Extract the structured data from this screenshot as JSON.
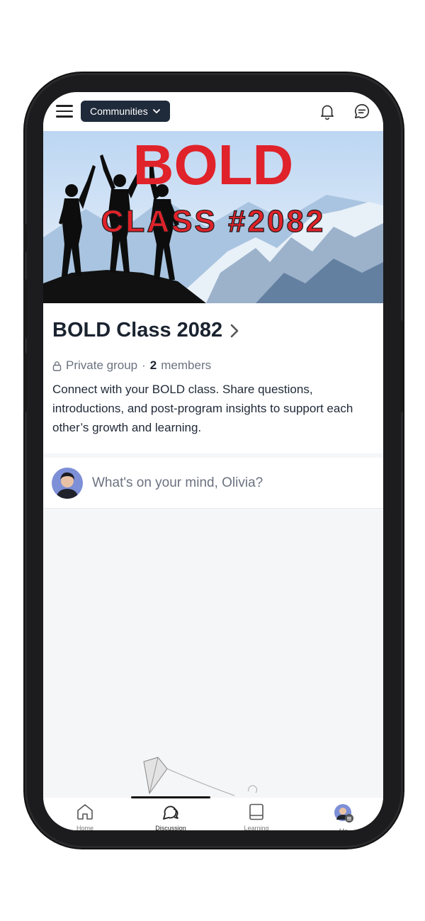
{
  "header": {
    "communities_label": "Communities",
    "icons": [
      "menu-icon",
      "chevron-down-icon",
      "bell-icon",
      "chat-icon"
    ]
  },
  "hero": {
    "banner_title": "BOLD",
    "banner_subtitle": "CLASS #2082",
    "accent_color": "#e0222a"
  },
  "group": {
    "name": "BOLD Class 2082",
    "privacy": "Private group",
    "member_count": "2",
    "members_label": "members",
    "description": "Connect with your BOLD class. Share questions, introductions, and post-program insights to support each other’s growth and learning."
  },
  "composer": {
    "placeholder": "What's on your mind, Olivia?"
  },
  "bottom_nav": {
    "items": [
      {
        "label": "Home",
        "icon": "home-icon"
      },
      {
        "label": "Discussion",
        "icon": "discussion-icon"
      },
      {
        "label": "Learning",
        "icon": "book-icon"
      },
      {
        "label": "Me",
        "icon": "avatar"
      }
    ]
  }
}
